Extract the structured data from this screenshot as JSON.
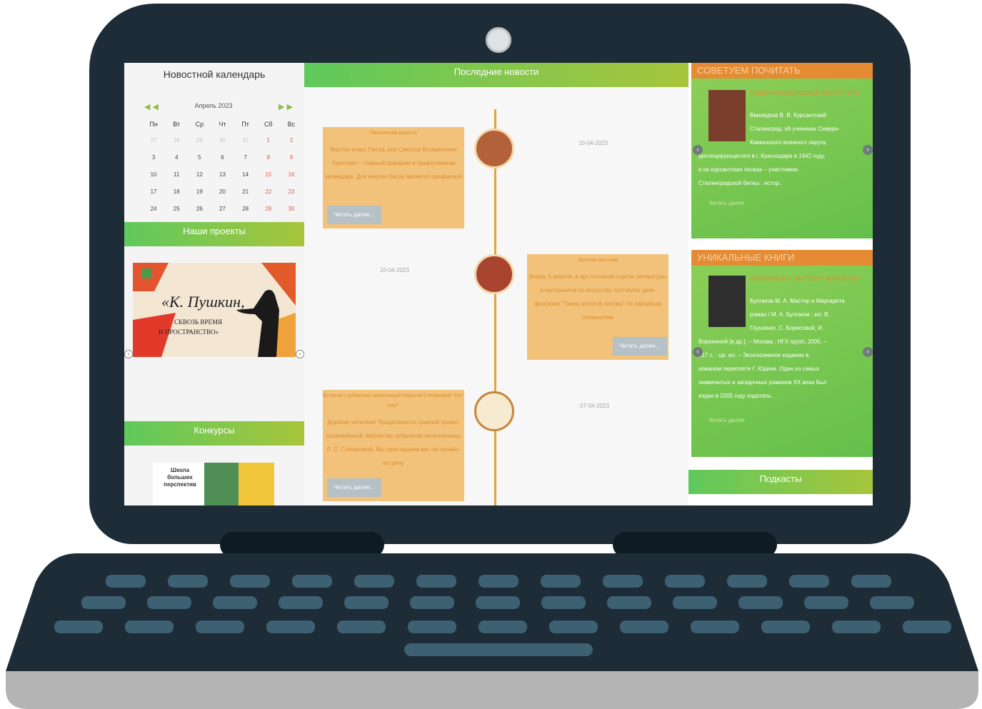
{
  "calendar": {
    "title": "Новостной календарь",
    "month": "Апрель 2023",
    "prev": "◀ ◀",
    "next": "▶ ▶",
    "weekdays": [
      "Пн",
      "Вт",
      "Ср",
      "Чт",
      "Пт",
      "Сб",
      "Вс"
    ],
    "weeks": [
      [
        "27",
        "28",
        "29",
        "30",
        "31",
        "1",
        "2"
      ],
      [
        "3",
        "4",
        "5",
        "6",
        "7",
        "8",
        "9"
      ],
      [
        "10",
        "11",
        "12",
        "13",
        "14",
        "15",
        "16"
      ],
      [
        "17",
        "18",
        "19",
        "20",
        "21",
        "22",
        "23"
      ],
      [
        "24",
        "25",
        "26",
        "27",
        "28",
        "29",
        "30"
      ]
    ]
  },
  "projects": {
    "title": "Наши проекты",
    "banner_line1": "«К. Пушкин,",
    "banner_line2": "СКВОЗЬ ВРЕМЯ",
    "banner_line3": "И ПРОСТРАНСТВО»"
  },
  "contests": {
    "title": "Конкурсы",
    "banner_text": "Школа больших перспектив"
  },
  "news": {
    "title": "Последние новости",
    "items": [
      {
        "title": "Пасхальная радость",
        "text": "Мастер-класс Пасха, или Светлое Воскресение Христово – главный праздник в православном календаре. Для многих Пасха является прекрасной",
        "date": "10-04-2023",
        "read_more": "Читать далее..."
      },
      {
        "title": "Золотая хохлома",
        "text": "Вчера, 5 апреля, в арт-гостиной отдела литературы и материалов по искусству состоялся урок-фантазия \"Танец золотой листвы\" по народным промыслам",
        "date": "10-04-2023",
        "read_more": "Читать далее..."
      },
      {
        "title": "Встречи с кубанской сказочницей Ларисой Степановой \"Кот-плут\"",
        "text": "Дорогие читатели! Продолжается грамзой проект, посвящённый творчеству кубанской писательницы Л. С. Степановой. Мы приглашаем вас на онлайн-встречу",
        "date": "07-04-2023",
        "read_more": "Читать далее..."
      }
    ]
  },
  "recommend": {
    "title": "СОВЕТУЕМ ПОЧИТАТЬ",
    "book_title": "ОТДЕЛ КРАЕВЕДЧЕСКОЙ ЛИТЕРАТУРЫ",
    "text_lines": [
      "Винокуров В. В. Курсантский",
      "Сталинград: об учениках Северо-",
      "Кавказского военного округа,",
      "дислоцирующегося в г. Краснодаре в 1942 году,",
      "и их курсантских полках – участниках",
      "Сталинградской битвы : истор.."
    ],
    "link": "Читать далее"
  },
  "unique": {
    "title": "УНИКАЛЬНЫЕ КНИГИ",
    "book_title": "БУЛГАКОВ М. А. МАСТЕР И МАРГАРИТА",
    "text_lines": [
      "Булгаков М. А. Мастер и Маргарита",
      "роман / М. А. Булгаков ; ил. В.",
      "Глушенко, С. Борисовой, И.",
      "Ворониной [и др.]. – Москва : НГХ групп, 2005. –",
      "617 с. : цв. ил. – Эксклюзивное издание в",
      "кожаном переплете Г. Юдина. Один из самых",
      "знаменитых и загадочных романов XX века был",
      "издан в 2005 году издатель.."
    ],
    "link": "Читать далее"
  },
  "podcasts": {
    "title": "Подкасты"
  },
  "colors": {
    "laptop_body": "#1d2c36",
    "accent_green": "#5fc95c",
    "accent_orange": "#e58b34",
    "card_bg": "#f2c27b"
  }
}
